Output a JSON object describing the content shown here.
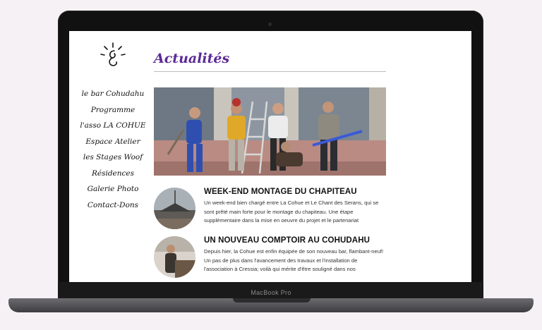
{
  "device": {
    "label": "MacBook Pro"
  },
  "site": {
    "page_title": "Actualités",
    "nav": [
      "le bar Cohudahu",
      "Programme",
      "l'asso LA COHUE",
      "Espace Atelier",
      "les Stages Woof",
      "Résidences",
      "Galerie Photo",
      "Contact-Dons"
    ],
    "articles": [
      {
        "title": "WEEK-END MONTAGE DU CHAPITEAU",
        "excerpt": "Un week-end bien chargé entre La Cohue et Le Chant des Serans, qui se sont prêté main forte pour le montage du chapiteau. Une étape supplémentaire dans la mise en oeuvre du projet et le partenariat"
      },
      {
        "title": "UN NOUVEAU COMPTOIR AU COHUDAHU",
        "excerpt": "Depuis hier, la Cohue est enfin équipée de son nouveau bar, flambant-neuf! Un pas de plus dans l'avancement des travaux et l'installation de l'association à Cressia; voilà qui mérite d'être souligné dans nos"
      }
    ]
  },
  "colors": {
    "title": "#5b2a95",
    "background": "#f6f1f4"
  },
  "icons": {
    "logo": "lightbulb-logo-icon"
  }
}
